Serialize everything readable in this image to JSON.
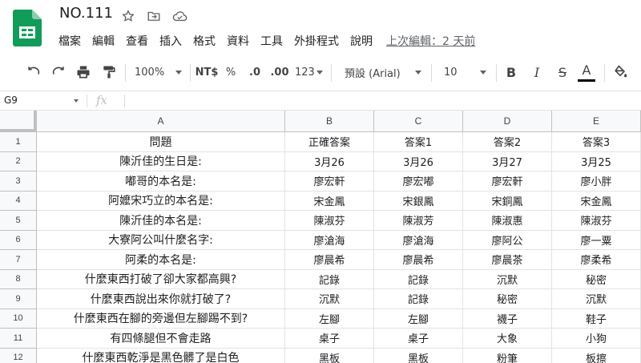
{
  "doc": {
    "title": "NO.111"
  },
  "menu": [
    "檔案",
    "編輯",
    "查看",
    "插入",
    "格式",
    "資料",
    "工具",
    "外掛程式",
    "說明"
  ],
  "last_edit": "上次編輯：2 天前",
  "toolbar": {
    "zoom": "100%",
    "currency": "NT$",
    "percent": "%",
    "decrease_decimal": ".0",
    "increase_decimal": ".00",
    "more_formats": "123",
    "font": "預設 (Arial)",
    "font_size": "10",
    "bold": "B",
    "italic": "I",
    "strike": "S",
    "text_color": "A"
  },
  "formula_bar": {
    "cell_ref": "G9",
    "fx": "fx"
  },
  "columns": [
    "A",
    "B",
    "C",
    "D",
    "E"
  ],
  "rows": [
    {
      "num": "1",
      "cells": [
        "問題",
        "正確答案",
        "答案1",
        "答案2",
        "答案3"
      ]
    },
    {
      "num": "2",
      "cells": [
        "陳沂佳的生日是:",
        "3月26",
        "3月26",
        "3月27",
        "3月25"
      ]
    },
    {
      "num": "3",
      "cells": [
        "嘟哥的本名是:",
        "廖宏軒",
        "廖宏嘟",
        "廖宏軒",
        "廖小胖"
      ]
    },
    {
      "num": "4",
      "cells": [
        "阿嬤宋巧立的本名是:",
        "宋金鳳",
        "宋銀鳳",
        "宋銅鳳",
        "宋金鳳"
      ]
    },
    {
      "num": "5",
      "cells": [
        "陳沂佳的本名是:",
        "陳淑芬",
        "陳淑芳",
        "陳淑惠",
        "陳淑芬"
      ]
    },
    {
      "num": "6",
      "cells": [
        "大寮阿公叫什麼名字:",
        "廖滄海",
        "廖滄海",
        "廖阿公",
        "廖一粟"
      ]
    },
    {
      "num": "7",
      "cells": [
        "阿柔的本名是:",
        "廖晨希",
        "廖晨希",
        "廖晨茶",
        "廖柔希"
      ]
    },
    {
      "num": "8",
      "cells": [
        "什麼東西打破了卻大家都高興?",
        "記錄",
        "記錄",
        "沉默",
        "秘密"
      ]
    },
    {
      "num": "9",
      "cells": [
        "什麼東西說出來你就打破了?",
        "沉默",
        "記錄",
        "秘密",
        "沉默"
      ]
    },
    {
      "num": "10",
      "cells": [
        "什麼東西在腳的旁邊但左腳踢不到?",
        "左腳",
        "左腳",
        "襪子",
        "鞋子"
      ]
    },
    {
      "num": "11",
      "cells": [
        "有四條腿但不會走路",
        "桌子",
        "桌子",
        "大象",
        "小狗"
      ]
    },
    {
      "num": "12",
      "cells": [
        "什麼東西乾淨是黑色髒了是白色",
        "黑板",
        "黑板",
        "粉筆",
        "板擦"
      ]
    }
  ],
  "colors": {
    "logo": "#0f9d58",
    "grid_line": "#e2e3e3",
    "header_bg": "#f8f9fa"
  }
}
